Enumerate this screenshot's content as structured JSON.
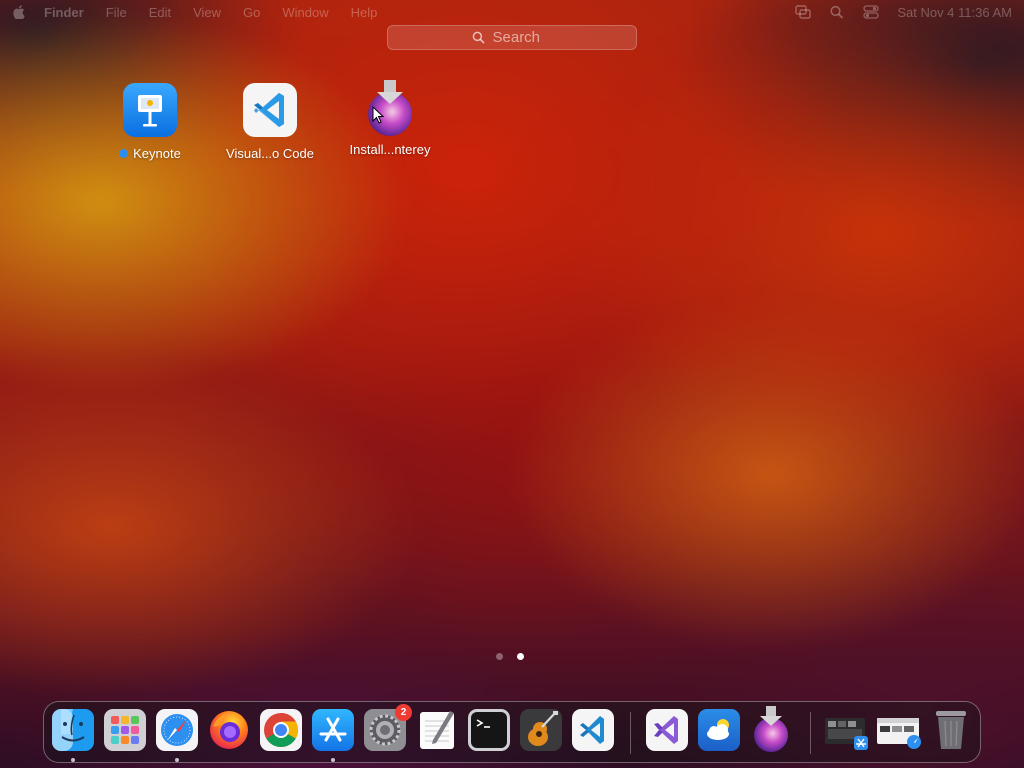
{
  "menubar": {
    "apple_icon": "apple-logo-icon",
    "app_name": "Finder",
    "menus": [
      "File",
      "Edit",
      "View",
      "Go",
      "Window",
      "Help"
    ],
    "status_icons": [
      "screen-mirroring-icon",
      "spotlight-search-icon",
      "control-center-icon"
    ],
    "clock": "Sat Nov 4  11:36 AM"
  },
  "search": {
    "placeholder": "Search",
    "icon": "search-icon"
  },
  "launchpad": {
    "apps": [
      {
        "label": "Keynote",
        "icon": "keynote-icon",
        "new": true
      },
      {
        "label": "Visual...o Code",
        "icon": "vscode-icon",
        "new": false
      },
      {
        "label": "Install...nterey",
        "icon": "install-monterey-icon",
        "new": false
      }
    ],
    "current_page": 2,
    "page_count": 2
  },
  "dock": {
    "apps": [
      {
        "name": "Finder",
        "icon": "finder-icon",
        "running": true
      },
      {
        "name": "Launchpad",
        "icon": "launchpad-icon",
        "running": false
      },
      {
        "name": "Safari",
        "icon": "safari-icon",
        "running": true
      },
      {
        "name": "Firefox",
        "icon": "firefox-icon",
        "running": false
      },
      {
        "name": "Google Chrome",
        "icon": "chrome-icon",
        "running": false
      },
      {
        "name": "App Store",
        "icon": "app-store-icon",
        "running": true
      },
      {
        "name": "System Preferences",
        "icon": "system-preferences-icon",
        "running": false,
        "badge": "2"
      },
      {
        "name": "TextEdit",
        "icon": "textedit-icon",
        "running": false
      },
      {
        "name": "Terminal",
        "icon": "terminal-icon",
        "running": false
      },
      {
        "name": "GarageBand",
        "icon": "garageband-icon",
        "running": false
      },
      {
        "name": "Visual Studio Code",
        "icon": "vscode-icon",
        "running": false
      }
    ],
    "recent_apps": [
      {
        "name": "Visual Studio",
        "icon": "visual-studio-icon"
      },
      {
        "name": "Weather",
        "icon": "weather-icon"
      },
      {
        "name": "Install macOS Monterey",
        "icon": "install-monterey-icon"
      }
    ],
    "stack_items": [
      {
        "name": "Downloads",
        "icon": "downloads-stack-icon"
      },
      {
        "name": "Documents",
        "icon": "documents-stack-icon"
      },
      {
        "name": "Trash",
        "icon": "trash-icon"
      }
    ]
  },
  "colors": {
    "accent": "#2f8cf0",
    "badge": "#f03b32"
  }
}
